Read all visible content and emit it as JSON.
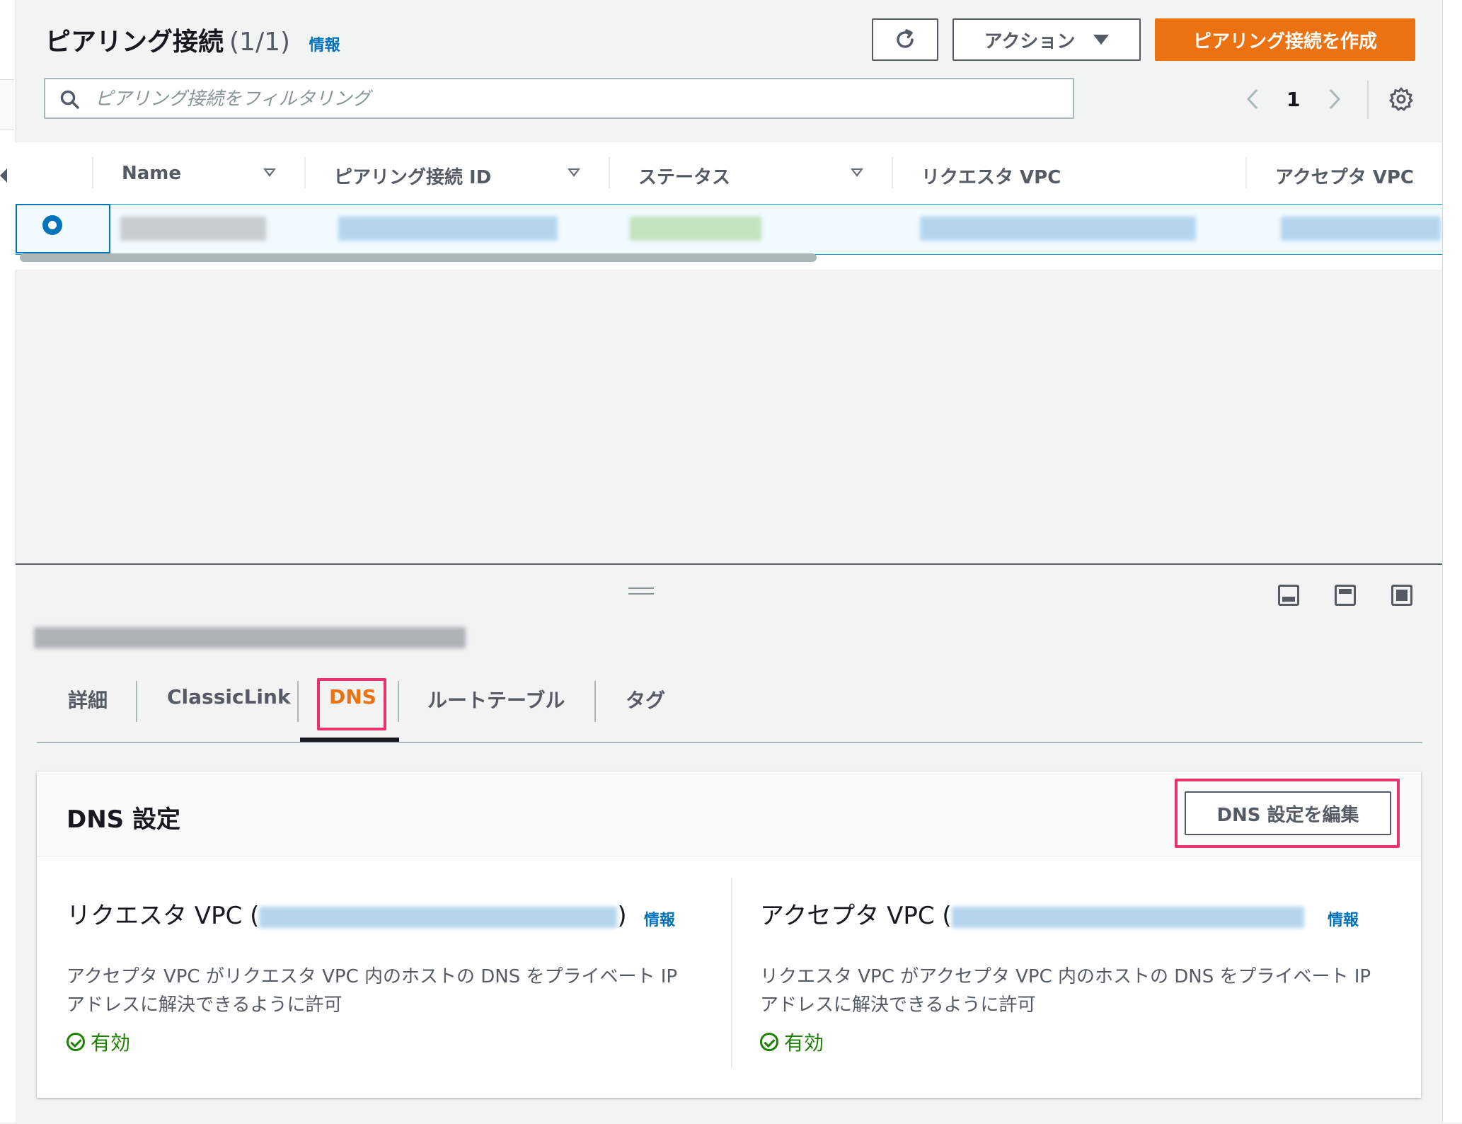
{
  "header": {
    "title": "ピアリング接続",
    "count": "(1/1)",
    "info": "情報",
    "refresh_icon": "refresh-icon",
    "actions_label": "アクション",
    "create_label": "ピアリング接続を作成"
  },
  "filter": {
    "placeholder": "ピアリング接続をフィルタリング"
  },
  "pagination": {
    "page": "1"
  },
  "table": {
    "columns": [
      "Name",
      "ピアリング接続 ID",
      "ステータス",
      "リクエスタ VPC",
      "アクセプタ VPC"
    ]
  },
  "tabs": [
    "詳細",
    "ClassicLink",
    "DNS",
    "ルートテーブル",
    "タグ"
  ],
  "active_tab": "DNS",
  "dns": {
    "title": "DNS 設定",
    "edit_label": "DNS 設定を編集",
    "requester": {
      "title_prefix": "リクエスタ VPC (",
      "title_suffix": ")",
      "info": "情報",
      "description": "アクセプタ VPC がリクエスタ VPC 内のホストの DNS をプライベート IP アドレスに解決できるように許可",
      "status": "有効"
    },
    "accepter": {
      "title_prefix": "アクセプタ VPC (",
      "info": "情報",
      "description": "リクエスタ VPC がアクセプタ VPC 内のホストの DNS をプライベート IP アドレスに解決できるように許可",
      "status": "有効"
    }
  },
  "colors": {
    "primary": "#ec7211",
    "link": "#0073bb",
    "success": "#1d8102",
    "highlight": "#e8336d"
  }
}
